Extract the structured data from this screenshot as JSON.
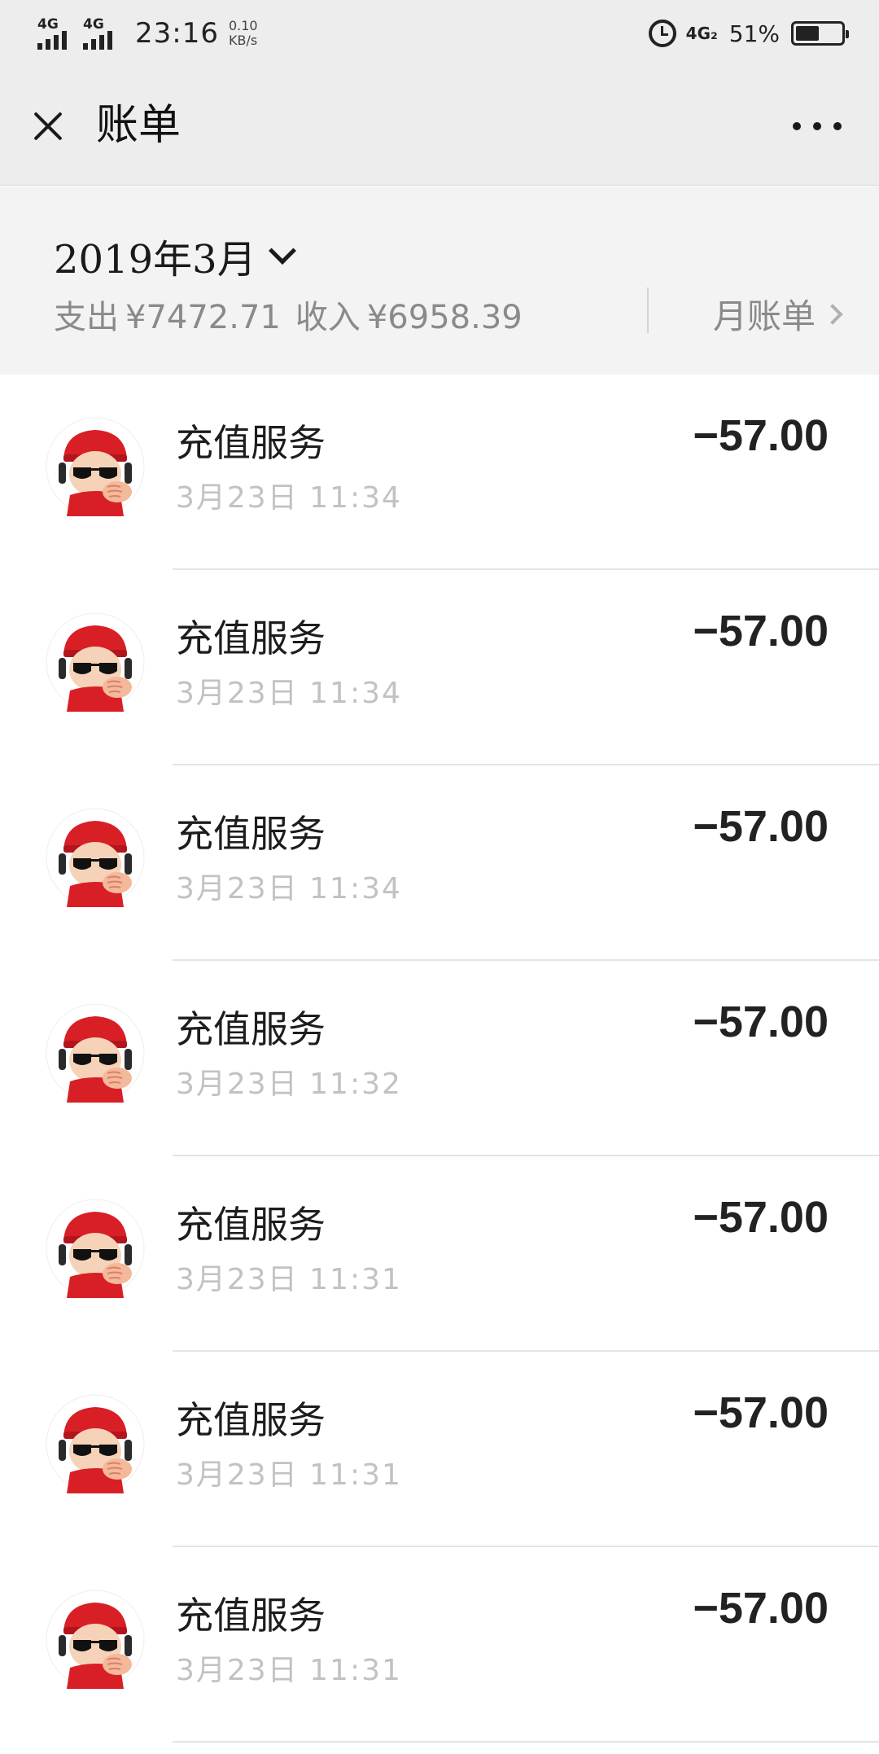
{
  "status_bar": {
    "signal1": "4G",
    "signal2": "4G",
    "time": "23:16",
    "speed_value": "0.10",
    "speed_unit": "KB/s",
    "net_label": "4G₂",
    "battery_text": "51%",
    "battery_level": 0.51
  },
  "header": {
    "close_icon": "close-icon",
    "title": "账单",
    "more_icon": "more-icon"
  },
  "summary": {
    "month": "2019年3月",
    "expense_label": "支出",
    "expense_amount": "¥7472.71",
    "income_label": "收入",
    "income_amount": "¥6958.39",
    "monthly_link": "月账单"
  },
  "transactions": [
    {
      "title": "充值服务",
      "time": "3月23日 11:34",
      "amount": "−57.00"
    },
    {
      "title": "充值服务",
      "time": "3月23日 11:34",
      "amount": "−57.00"
    },
    {
      "title": "充值服务",
      "time": "3月23日 11:34",
      "amount": "−57.00"
    },
    {
      "title": "充值服务",
      "time": "3月23日 11:32",
      "amount": "−57.00"
    },
    {
      "title": "充值服务",
      "time": "3月23日 11:31",
      "amount": "−57.00"
    },
    {
      "title": "充值服务",
      "time": "3月23日 11:31",
      "amount": "−57.00"
    },
    {
      "title": "充值服务",
      "time": "3月23日 11:31",
      "amount": "−57.00"
    }
  ]
}
